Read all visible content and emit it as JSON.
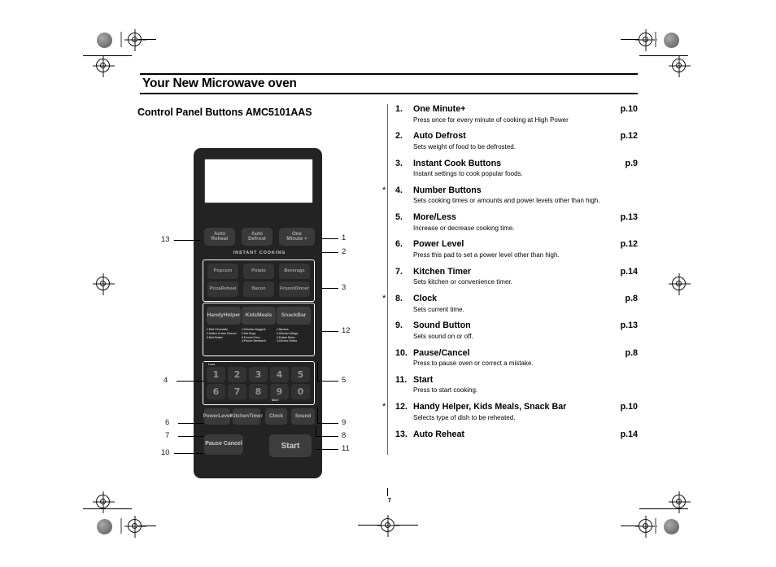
{
  "page": {
    "title": "Your New Microwave oven",
    "section_title": "Control Panel Buttons AMC5101AAS",
    "page_number": "7"
  },
  "list": [
    {
      "num": "1.",
      "label": "One Minute+",
      "page": "p.10",
      "desc": "Press once for every minute of cooking at High Power",
      "star": ""
    },
    {
      "num": "2.",
      "label": "Auto Defrost",
      "page": "p.12",
      "desc": "Sets weight of food to be defrosted.",
      "star": ""
    },
    {
      "num": "3.",
      "label": "Instant Cook Buttons",
      "page": "p.9",
      "desc": "Instant settings to cook popular foods.",
      "star": ""
    },
    {
      "num": "4.",
      "label": "Number Buttons",
      "page": "",
      "desc": "Sets cooking times or amounts and power levels other than high.",
      "star": "*"
    },
    {
      "num": "5.",
      "label": "More/Less",
      "page": "p.13",
      "desc": "Increase or decrease cooking time.",
      "star": ""
    },
    {
      "num": "6.",
      "label": "Power Level",
      "page": "p.12",
      "desc": "Press this pad to set a power level other than high.",
      "star": ""
    },
    {
      "num": "7.",
      "label": "Kitchen Timer",
      "page": "p.14",
      "desc": "Sets kitchen or convenience timer.",
      "star": ""
    },
    {
      "num": "8.",
      "label": "Clock",
      "page": "p.8",
      "desc": "Sets current time.",
      "star": "*"
    },
    {
      "num": "9.",
      "label": "Sound Button",
      "page": "p.13",
      "desc": "Sets sound on or off.",
      "star": ""
    },
    {
      "num": "10.",
      "label": "Pause/Cancel",
      "page": "p.8",
      "desc": "Press to pause oven or correct a mistake.",
      "star": ""
    },
    {
      "num": "11.",
      "label": "Start",
      "page": "",
      "desc": "Press to start cooking.",
      "star": ""
    },
    {
      "num": "12.",
      "label": "Handy Helper, Kids Meals, Snack Bar",
      "page": "p.10",
      "desc": "Selects type of dish to be reheated.",
      "star": "*"
    },
    {
      "num": "13.",
      "label": "Auto Reheat",
      "page": "p.14",
      "desc": "",
      "star": ""
    }
  ],
  "panel": {
    "top_buttons": [
      {
        "l1": "Auto",
        "l2": "Reheat"
      },
      {
        "l1": "Auto",
        "l2": "Defrost"
      },
      {
        "l1": "One",
        "l2": "Minute +"
      }
    ],
    "instant_cooking_label": "INSTANT COOKING",
    "instant_cook": [
      {
        "l1": "Popcorn",
        "l2": ""
      },
      {
        "l1": "Potato",
        "l2": ""
      },
      {
        "l1": "Beverage",
        "l2": ""
      },
      {
        "l1": "Pizza",
        "l2": "Reheat"
      },
      {
        "l1": "Bacon",
        "l2": ""
      },
      {
        "l1": "Frozen",
        "l2": "Dinner"
      }
    ],
    "helper_buttons": [
      {
        "l1": "Handy",
        "l2": "Helper"
      },
      {
        "l1": "Kids",
        "l2": "Meals"
      },
      {
        "l1": "Snack",
        "l2": "Bar"
      }
    ],
    "helper_lists": [
      [
        "1.Melt Chocolate",
        "2.Soften Cream Cheese",
        "3.Melt Butter"
      ],
      [
        "1.Chicken Nuggets",
        "2.Hot Dogs",
        "3.French Fries",
        "4.Frozen Sandwich"
      ],
      [
        "1.Nachos",
        "2.Chicken Wings",
        "3.Potato Skins",
        "4.Cheese Sticks"
      ]
    ],
    "numbers_row1": [
      "1",
      "2",
      "3",
      "4",
      "5"
    ],
    "numbers_row2": [
      "6",
      "7",
      "8",
      "9",
      "0"
    ],
    "less_label": "Less",
    "more_label": "More",
    "function_buttons": [
      {
        "l1": "Power",
        "l2": "Level"
      },
      {
        "l1": "Kitchen",
        "l2": "Timer"
      },
      {
        "l1": "Clock",
        "l2": ""
      },
      {
        "l1": "Sound",
        "l2": ""
      }
    ],
    "pause": {
      "l1": "Pause",
      "l2": "Cancel"
    },
    "start": "Start"
  },
  "callouts": {
    "left": [
      "13",
      "4",
      "6",
      "7",
      "10"
    ],
    "right": [
      "1",
      "2",
      "3",
      "12",
      "5",
      "9",
      "8",
      "11"
    ]
  },
  "colors": {
    "panel_bg": "#232323",
    "button_bg": "#3a3a3a",
    "display_bg": "#ffffff",
    "text": "#000000"
  }
}
